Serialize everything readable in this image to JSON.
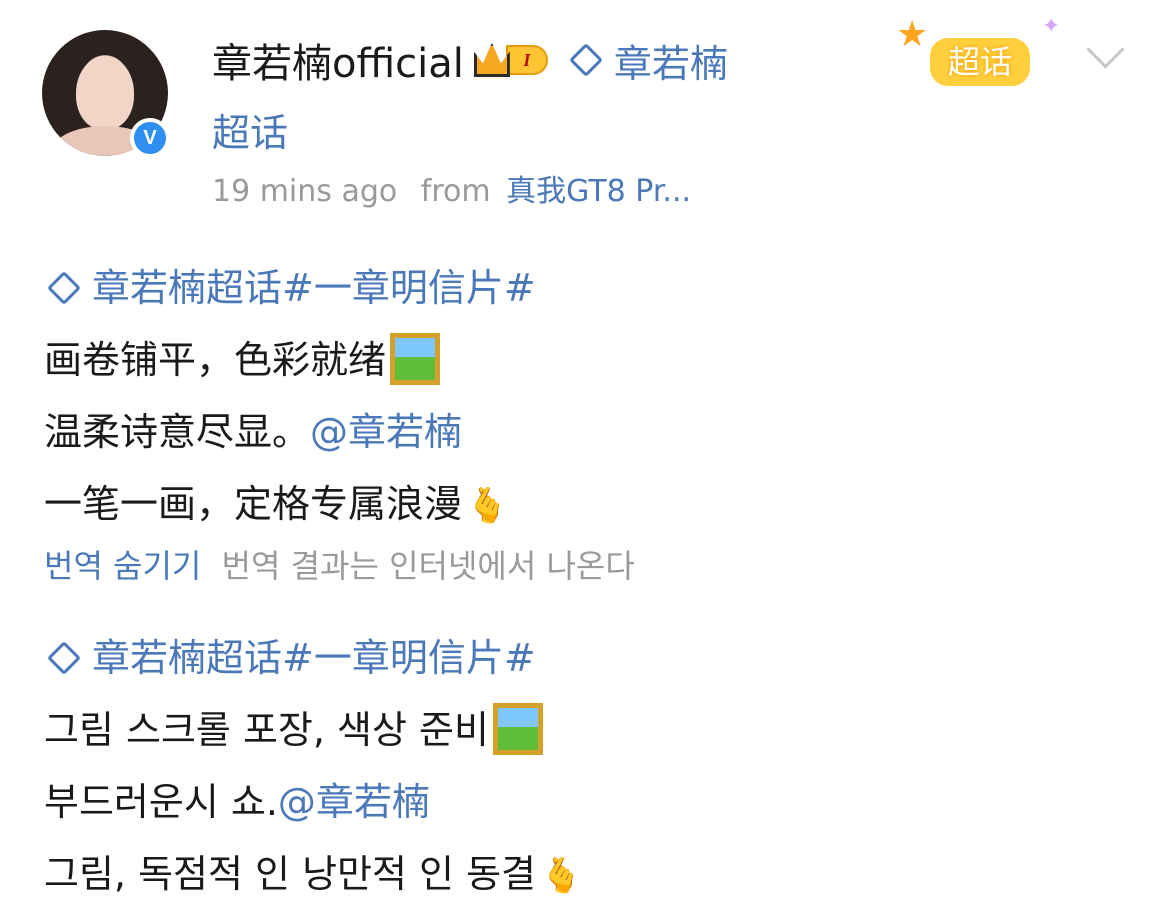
{
  "profile": {
    "username": "章若楠official",
    "level": "I",
    "supertopic_name": "章若楠",
    "supertopic_suffix": "超话",
    "time_ago": "19 mins ago",
    "from_label": "from",
    "device": "真我GT8 Pr..."
  },
  "header_badge": {
    "label": "超话"
  },
  "post": {
    "original": {
      "topic": "章若楠超话#一章明信片#",
      "line1": "画卷铺平，色彩就绪",
      "line2_text": "温柔诗意尽显。",
      "line2_mention": "@章若楠",
      "line3": "一笔一画，定格专属浪漫"
    },
    "translation_bar": {
      "hide_label": "번역 숨기기",
      "note": "번역 결과는 인터넷에서 나온다"
    },
    "translated": {
      "topic": "章若楠超话#一章明信片#",
      "line1": "그림 스크롤 포장, 색상 준비",
      "line2_text": "부드러운시 쇼.",
      "line2_mention": "@章若楠",
      "line3": "그림, 독점적 인 낭만적 인 동결"
    }
  },
  "icons": {
    "avatar": "profile-photo",
    "verified": "blue-v-badge",
    "crown": "crown-icon",
    "diamond": "supertopic-diamond-icon",
    "chevron": "chevron-down-icon",
    "picture_emoji": "framed-picture-emoji",
    "heart_emoji": "finger-heart-emoji"
  },
  "colors": {
    "link": "#4a78b8",
    "meta": "#9a9a9a",
    "badge": "#ffcf3d"
  }
}
